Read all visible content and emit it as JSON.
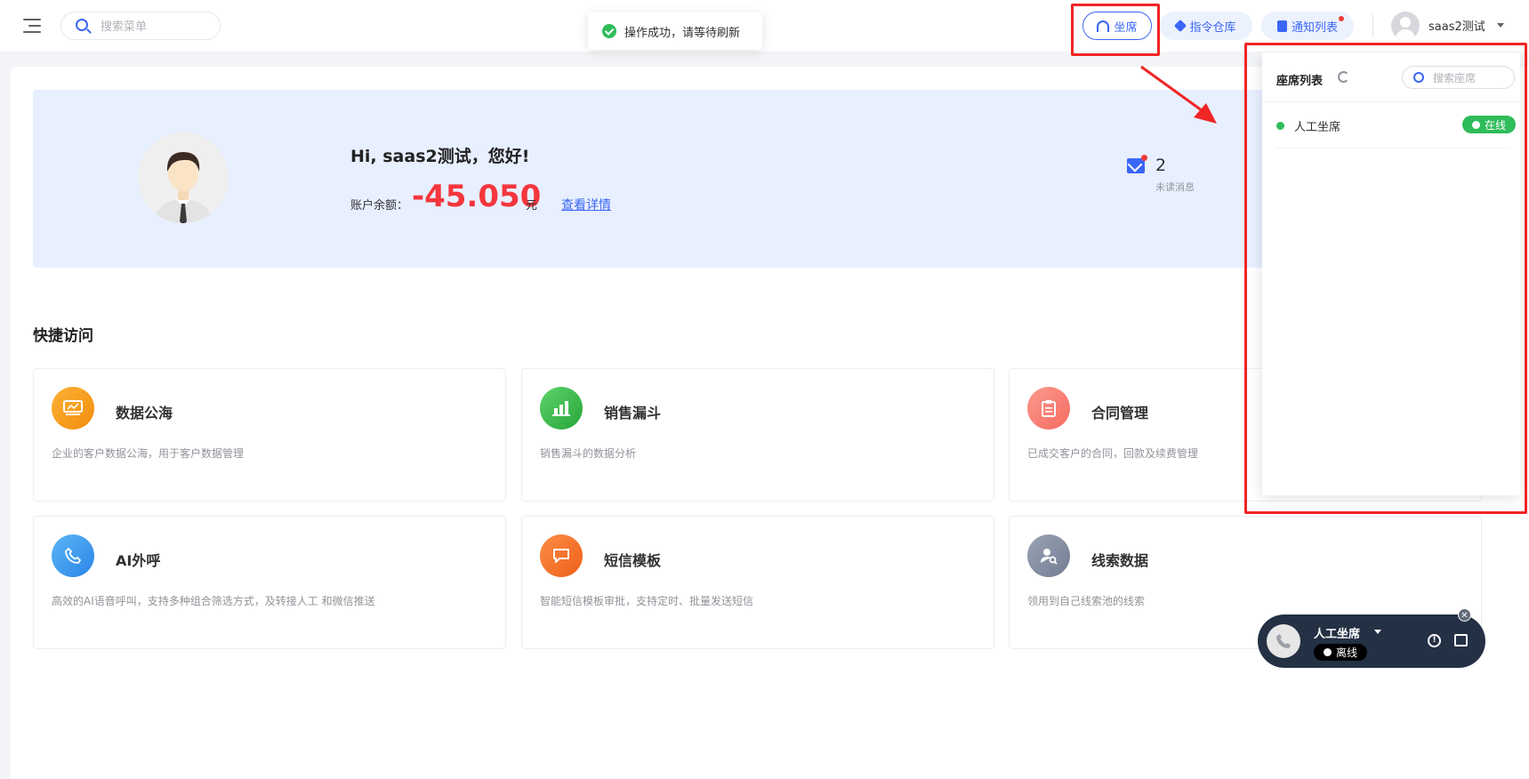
{
  "header": {
    "search_placeholder": "搜索菜单",
    "toast_message": "操作成功，请等待刷新",
    "agent_button": "坐席",
    "command_button": "指令仓库",
    "notify_button": "通知列表",
    "username": "saas2测试"
  },
  "banner": {
    "greeting": "Hi, saas2测试，您好!",
    "balance_label": "账户余额：",
    "balance_value": "-45.050",
    "balance_unit": "元",
    "detail_link": "查看详情",
    "unread_count": "2",
    "unread_label": "未读消息"
  },
  "quick_access": {
    "title": "快捷访问",
    "cards": [
      {
        "title": "数据公海",
        "desc": "企业的客户数据公海，用于客户数据管理",
        "icon": "monitor-icon",
        "color": "#f7a21b"
      },
      {
        "title": "销售漏斗",
        "desc": "销售漏斗的数据分析",
        "icon": "bar-chart-icon",
        "color": "#3ebd4f"
      },
      {
        "title": "合同管理",
        "desc": "已成交客户的合同，回款及续费管理",
        "icon": "clipboard-icon",
        "color": "#f87a70"
      },
      {
        "title": "AI外呼",
        "desc": "高效的AI语音呼叫，支持多种组合筛选方式，及转接人工 和微信推送",
        "icon": "phone-icon",
        "color": "#3a9af0"
      },
      {
        "title": "短信模板",
        "desc": "智能短信模板审批，支持定时、批量发送短信",
        "icon": "message-icon",
        "color": "#f5742b"
      },
      {
        "title": "线索数据",
        "desc": "领用到自己线索池的线索",
        "icon": "user-search-icon",
        "color": "#8891a4"
      }
    ]
  },
  "seat_panel": {
    "title": "座席列表",
    "search_placeholder": "搜索座席",
    "seats": [
      {
        "name": "人工坐席",
        "status": "在线"
      }
    ]
  },
  "call_widget": {
    "name": "人工坐席",
    "status": "离线"
  }
}
